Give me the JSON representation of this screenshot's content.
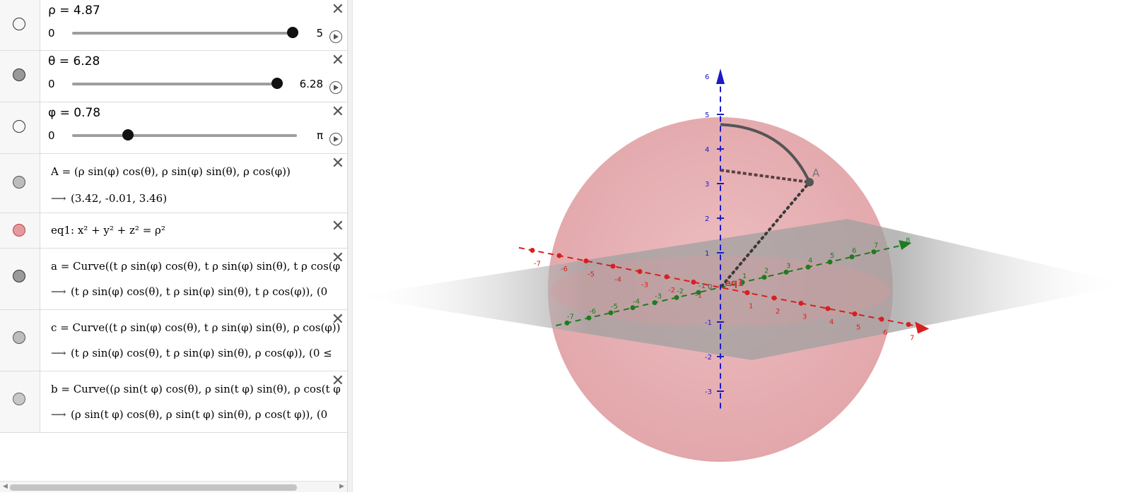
{
  "sliders": [
    {
      "label": "ρ = 4.87",
      "min": "0",
      "max": "5",
      "fraction": 0.974,
      "marble_fill": "#ffffff"
    },
    {
      "label": "θ = 6.28",
      "min": "0",
      "max": "6.28",
      "fraction": 1.0,
      "marble_fill": "#999999"
    },
    {
      "label": "φ = 0.78",
      "min": "0",
      "max": "π",
      "fraction": 0.248,
      "marble_fill": "#ffffff"
    }
  ],
  "point_A": {
    "definition": "A = (ρ  sin(φ)  cos(θ), ρ  sin(φ)  sin(θ), ρ  cos(φ))",
    "value": "(3.42, -0.01, 3.46)"
  },
  "eq1": {
    "definition": "eq1: x² + y² + z² = ρ²",
    "color": "#e79a9e"
  },
  "curve_a": {
    "definition": "a = Curve((t ρ  sin(φ)  cos(θ), t ρ  sin(φ)  sin(θ), t ρ  cos(φ)),",
    "value": "(t ρ  sin(φ)  cos(θ), t ρ  sin(φ)  sin(θ), t ρ  cos(φ)),    (0"
  },
  "curve_c": {
    "definition": "c = Curve((t ρ  sin(φ)  cos(θ), t ρ  sin(φ)  sin(θ), ρ  cos(φ)),",
    "value": "(t ρ  sin(φ)  cos(θ), t ρ  sin(φ)  sin(θ), ρ  cos(φ)),    (0 ≤"
  },
  "curve_b": {
    "definition": "b = Curve((ρ  sin(t φ)  cos(θ), ρ  sin(t φ)  sin(θ), ρ  cos(t φ)",
    "value": "(ρ  sin(t φ)  cos(θ), ρ  sin(t φ)  sin(θ), ρ  cos(t φ)),    (0"
  },
  "arrow_symbol": "⟶",
  "close_symbol": "✕",
  "graphics": {
    "point_label": "A",
    "surface_label": "eq1",
    "x_ticks": [
      "-7",
      "-6",
      "-5",
      "-4",
      "-3",
      "-2",
      "-1",
      "0",
      "1",
      "2",
      "3",
      "4",
      "5",
      "6",
      "7"
    ],
    "y_ticks": [
      "-7",
      "-6",
      "-5",
      "-4",
      "-3",
      "-2",
      "-1",
      "0",
      "1",
      "2",
      "3",
      "4",
      "5",
      "6",
      "7",
      "8"
    ],
    "z_ticks": [
      "-3",
      "-2",
      "-1",
      "0",
      "1",
      "2",
      "3",
      "4",
      "5",
      "6"
    ],
    "colors": {
      "x_axis": "#d91e1e",
      "y_axis": "#217a21",
      "z_axis": "#1a1ac8",
      "sphere": "#e6a6aa",
      "plane": "#9a9a9a"
    }
  }
}
